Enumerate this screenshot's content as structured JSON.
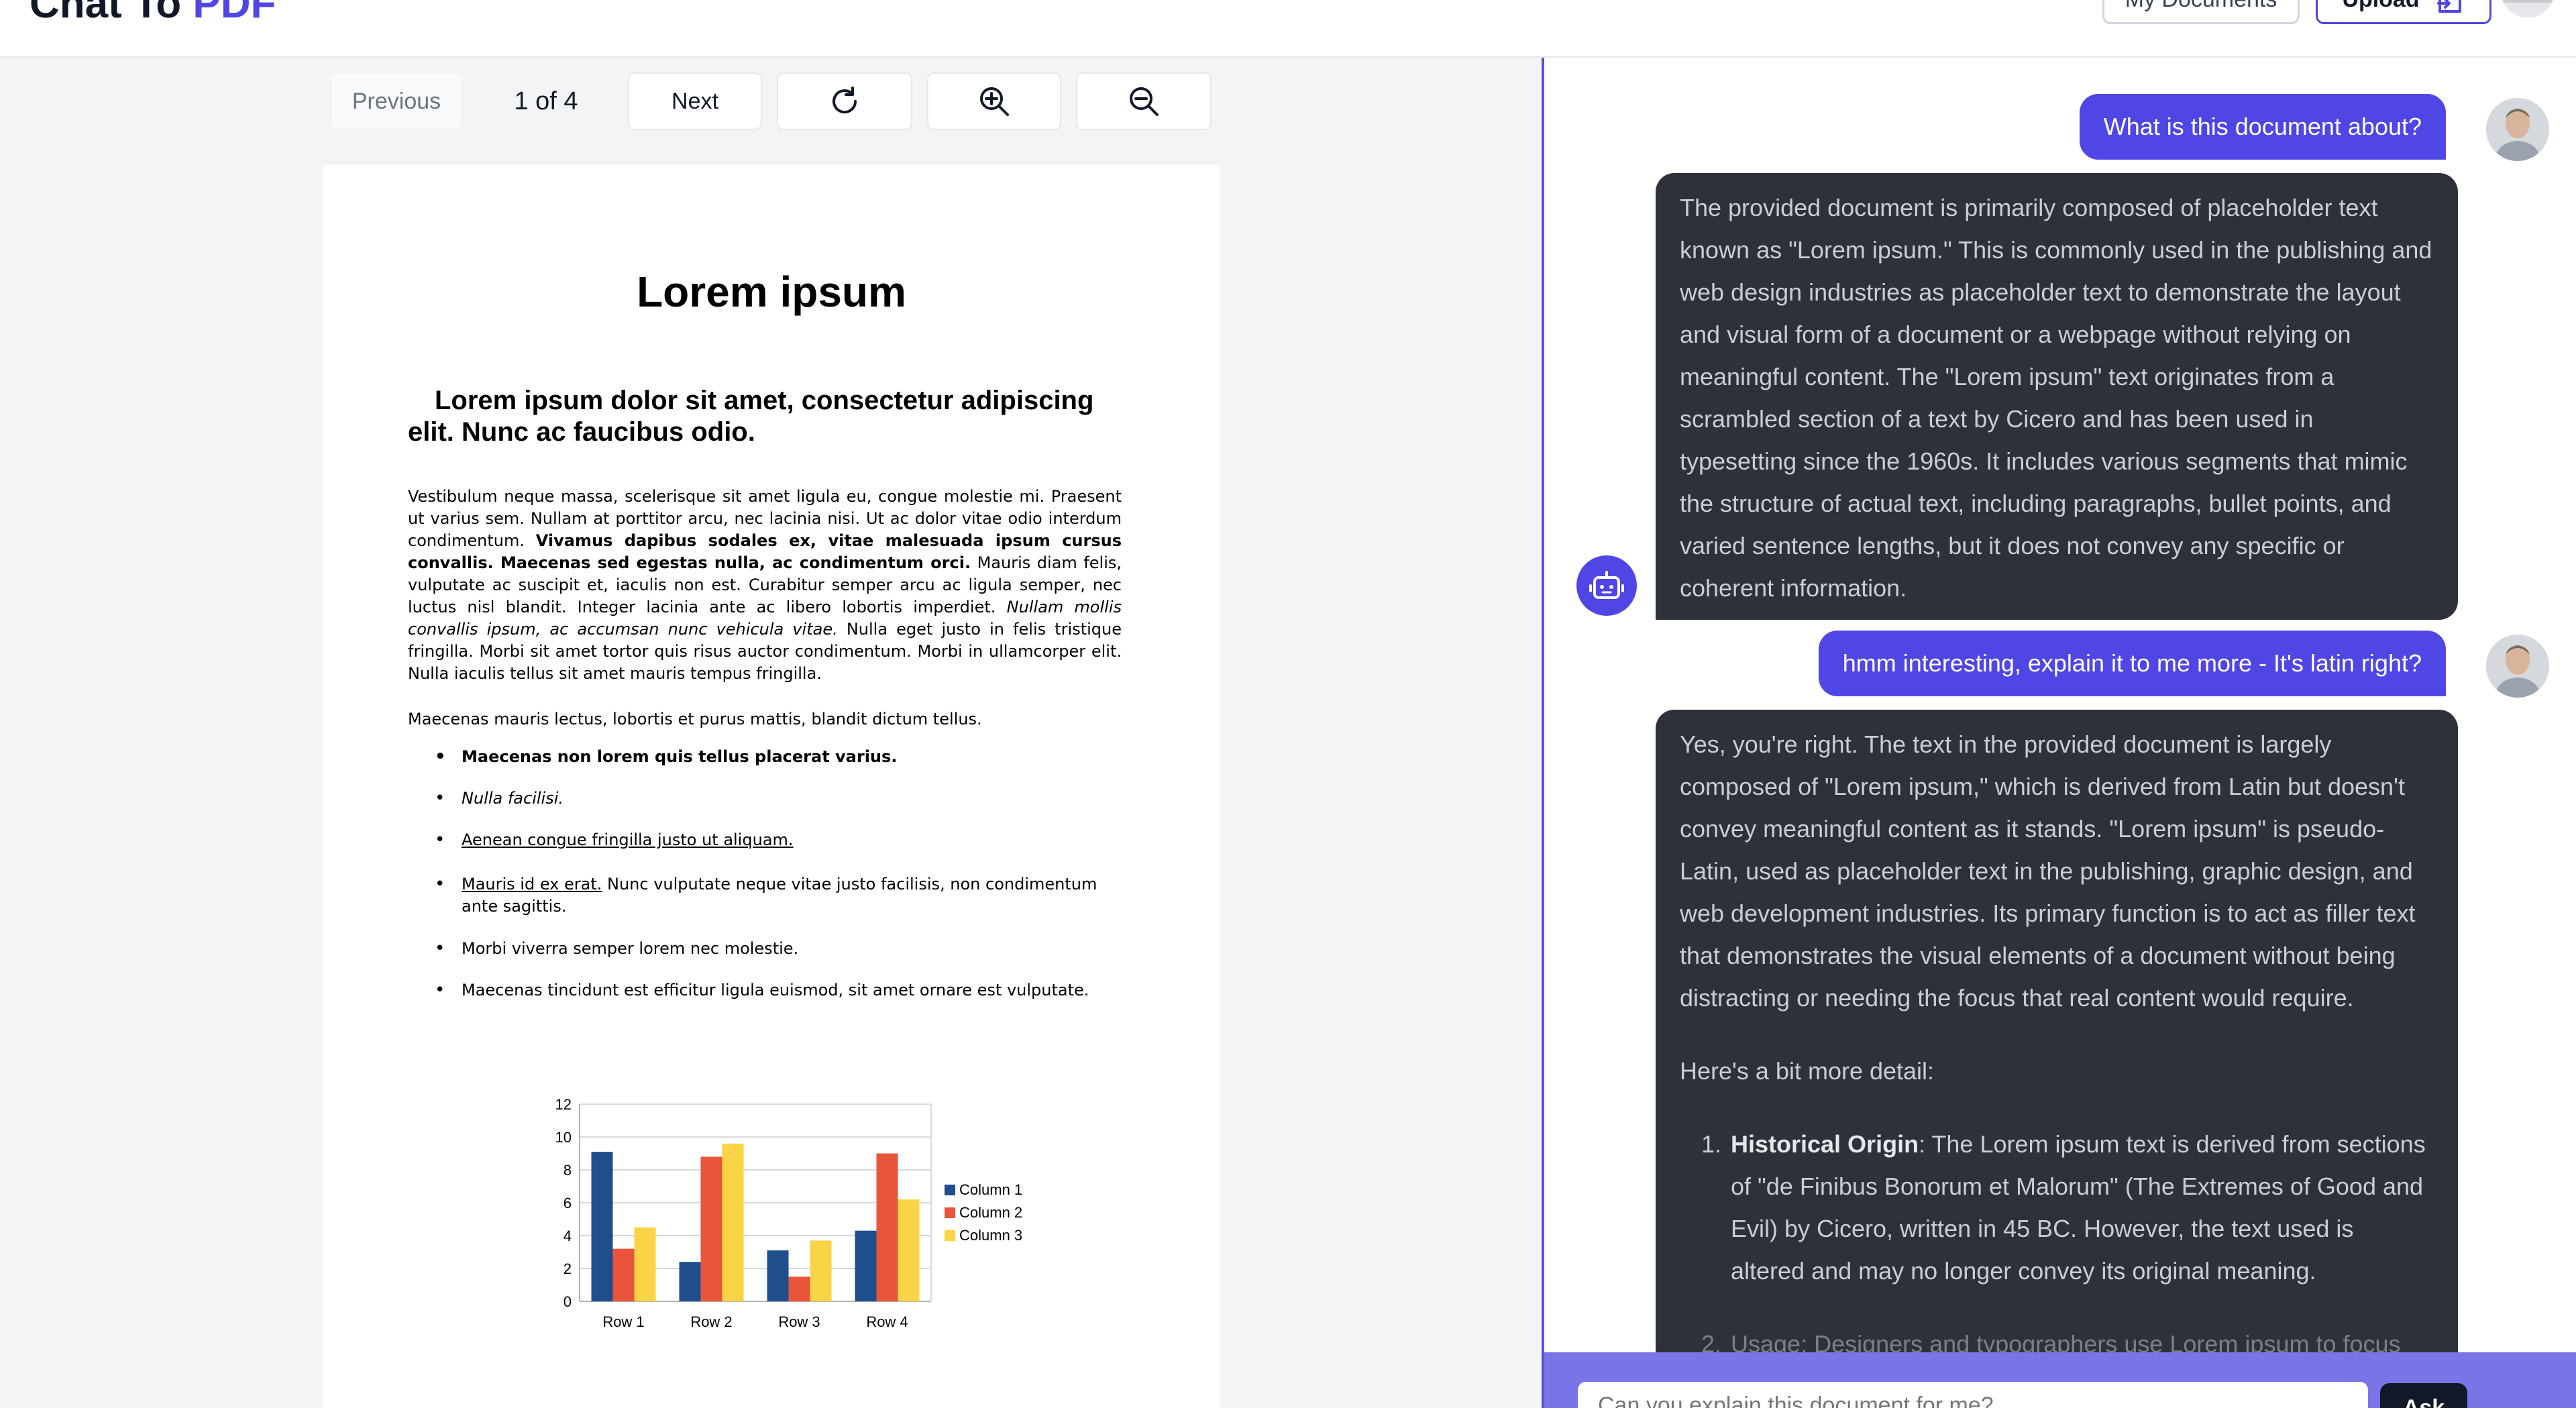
{
  "header": {
    "brand_main": "Chat To ",
    "brand_accent": "PDF",
    "my_documents": "My Documents",
    "upload": "Upload"
  },
  "toolbar": {
    "previous": "Previous",
    "page_indicator": "1 of 4",
    "next": "Next",
    "icons": [
      "rotate-icon",
      "zoom-in-icon",
      "zoom-out-icon"
    ]
  },
  "document": {
    "title": "Lorem ipsum",
    "subtitle": "Lorem ipsum dolor sit amet, consectetur adipiscing elit. Nunc ac faucibus odio.",
    "para1_a": "Vestibulum neque massa, scelerisque sit amet ligula eu, congue molestie mi. Praesent ut varius sem. Nullam at porttitor arcu, nec lacinia nisi. Ut ac dolor vitae odio interdum condimentum. ",
    "para1_b": "Vivamus dapibus sodales ex, vitae malesuada ipsum cursus convallis. Maecenas sed egestas nulla, ac condimentum orci.",
    "para1_c": " Mauris diam felis, vulputate ac suscipit et, iaculis non est. Curabitur semper arcu ac ligula semper, nec luctus nisl blandit. Integer lacinia ante ac libero lobortis imperdiet. ",
    "para1_d": "Nullam mollis convallis ipsum, ac accumsan nunc vehicula vitae.",
    "para1_e": " Nulla eget justo in felis tristique fringilla. Morbi sit amet tortor quis risus auctor condimentum. Morbi in ullamcorper elit. Nulla iaculis tellus sit amet mauris tempus fringilla.",
    "para2": "Maecenas mauris lectus, lobortis et purus mattis, blandit dictum tellus.",
    "list": {
      "item1": "Maecenas non lorem quis tellus placerat varius.",
      "item2": "Nulla facilisi.",
      "item3": "Aenean congue fringilla justo ut aliquam. ",
      "item4_u": "Mauris id ex erat.",
      "item4_rest": " Nunc vulputate neque vitae justo facilisis, non condimentum ante sagittis.",
      "item5": "Morbi viverra semper lorem nec molestie.",
      "item6": "Maecenas tincidunt est efficitur ligula euismod, sit amet ornare est vulputate."
    }
  },
  "chart_data": {
    "type": "bar",
    "categories": [
      "Row 1",
      "Row 2",
      "Row 3",
      "Row 4"
    ],
    "series": [
      {
        "name": "Column 1",
        "values": [
          9.1,
          2.4,
          3.1,
          4.3
        ],
        "color": "#1f4e8c"
      },
      {
        "name": "Column 2",
        "values": [
          3.2,
          8.8,
          1.5,
          9.0
        ],
        "color": "#e8553a"
      },
      {
        "name": "Column 3",
        "values": [
          4.5,
          9.6,
          3.7,
          6.2
        ],
        "color": "#f9d447"
      }
    ],
    "ylim": [
      0,
      12
    ],
    "yticks": [
      "0",
      "2",
      "4",
      "6",
      "8",
      "10",
      "12"
    ],
    "grid": true,
    "legend": "right"
  },
  "chat": {
    "q1": "What is this document about?",
    "a1": "The provided document is primarily composed of placeholder text known as \"Lorem ipsum.\" This is commonly used in the publishing and web design industries as placeholder text to demonstrate the layout and visual form of a document or a webpage without relying on meaningful content. The \"Lorem ipsum\" text originates from a scrambled section of a text by Cicero and has been used in typesetting since the 1960s. It includes various segments that mimic the structure of actual text, including paragraphs, bullet points, and varied sentence lengths, but it does not convey any specific or coherent information.",
    "q2": "hmm interesting, explain it to me more - It's latin right?",
    "a2_p1": "Yes, you're right. The text in the provided document is largely composed of \"Lorem ipsum,\" which is derived from Latin but doesn't convey meaningful content as it stands. \"Lorem ipsum\" is pseudo-Latin, used as placeholder text in the publishing, graphic design, and web development industries. Its primary function is to act as filler text that demonstrates the visual elements of a document without being distracting or needing the focus that real content would require.",
    "a2_p2": "Here's a bit more detail:",
    "a2_li1_b": "Historical Origin",
    "a2_li1": ": The Lorem ipsum text is derived from sections of \"de Finibus Bonorum et Malorum\" (The Extremes of Good and Evil) by Cicero, written in 45 BC. However, the text used is altered and may no longer convey its original meaning.",
    "a2_li2": "Usage: Designers and typographers use Lorem ipsum to focus",
    "input_placeholder": "Can you explain this document for me?",
    "ask": "Ask"
  }
}
